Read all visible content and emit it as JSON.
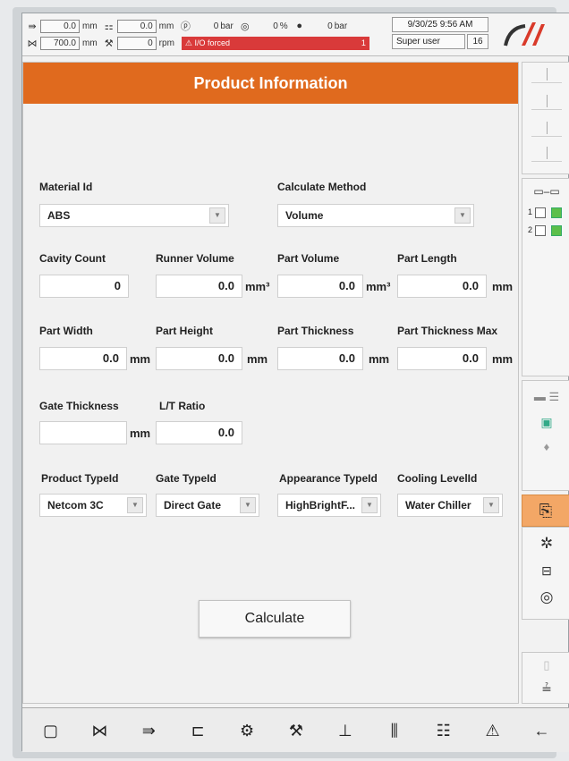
{
  "status_bar": {
    "row1": {
      "pos_value": "0.0",
      "pos_unit": "mm",
      "mold_value": "0.0",
      "mold_unit": "mm",
      "pressure_value": "0",
      "pressure_unit": "bar",
      "percent_value": "0",
      "percent_unit": "%",
      "p_value": "0",
      "p_unit": "bar"
    },
    "row2": {
      "stroke_value": "700.0",
      "stroke_unit": "mm",
      "screw_value": "0",
      "screw_unit": "rpm",
      "alarm_text": "I/O forced",
      "alarm_count": "1"
    },
    "datetime": "9/30/25 9:56 AM",
    "user": "Super user",
    "user_level": "16"
  },
  "panel": {
    "title": "Product Information",
    "material_id": {
      "label": "Material Id",
      "value": "ABS"
    },
    "calculate_method": {
      "label": "Calculate Method",
      "value": "Volume"
    },
    "cavity_count": {
      "label": "Cavity Count",
      "value": "0"
    },
    "runner_volume": {
      "label": "Runner Volume",
      "value": "0.0",
      "unit": "mm³"
    },
    "part_volume": {
      "label": "Part Volume",
      "value": "0.0",
      "unit": "mm³"
    },
    "part_length": {
      "label": "Part Length",
      "value": "0.0",
      "unit": "mm"
    },
    "part_width": {
      "label": "Part Width",
      "value": "0.0",
      "unit": "mm"
    },
    "part_height": {
      "label": "Part Height",
      "value": "0.0",
      "unit": "mm"
    },
    "part_thickness": {
      "label": "Part Thickness",
      "value": "0.0",
      "unit": "mm"
    },
    "part_thickness_max": {
      "label": "Part Thickness Max",
      "value": "0.0",
      "unit": "mm"
    },
    "gate_thickness": {
      "label": "Gate Thickness",
      "value": "",
      "unit": "mm"
    },
    "lt_ratio": {
      "label": "L/T Ratio",
      "value": "0.0"
    },
    "product_type": {
      "label": "Product TypeId",
      "value": "Netcom 3C"
    },
    "gate_type": {
      "label": "Gate TypeId",
      "value": "Direct Gate"
    },
    "appearance_type": {
      "label": "Appearance TypeId",
      "value": "HighBrightF..."
    },
    "cooling_level": {
      "label": "Cooling LevelId",
      "value": "Water Chiller"
    },
    "calculate_button": "Calculate"
  },
  "sidebar": {
    "channel_1": "1",
    "channel_2": "2"
  },
  "colors": {
    "title_bar": "#e06a1e",
    "alarm": "#d93a3a",
    "active_side": "#f3a766"
  }
}
